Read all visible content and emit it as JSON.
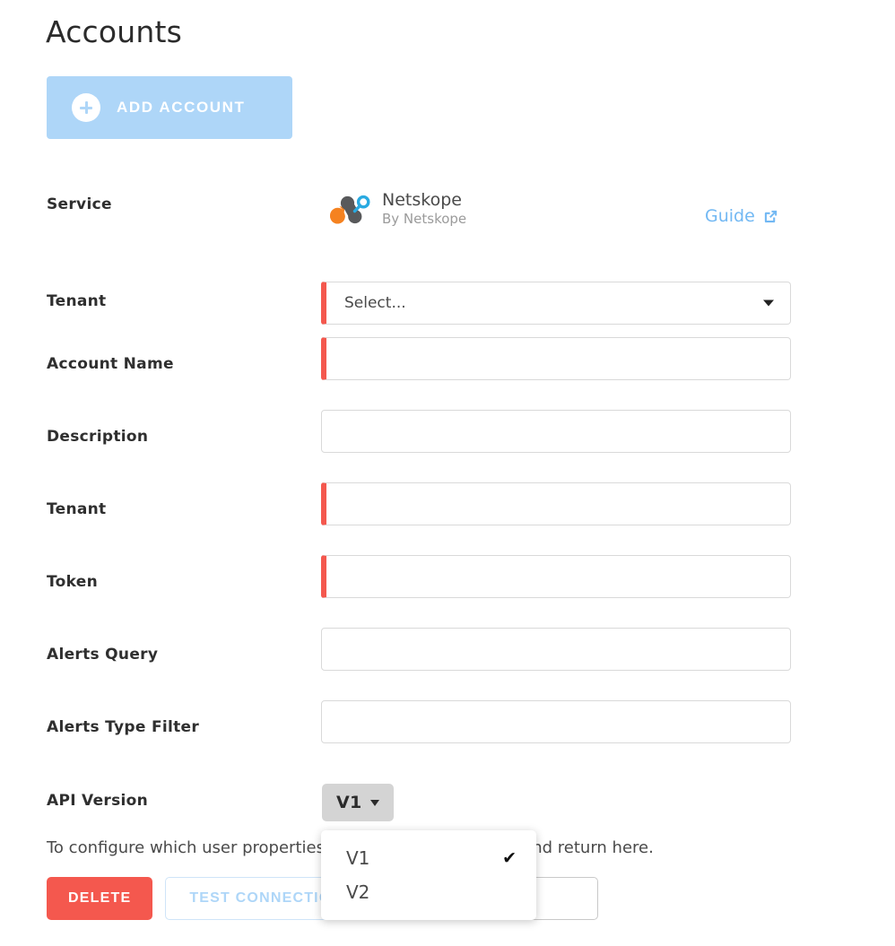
{
  "page": {
    "title": "Accounts"
  },
  "toolbar": {
    "add_account_label": "ADD ACCOUNT",
    "add_icon": "plus-circle-icon"
  },
  "service": {
    "label": "Service",
    "name": "Netskope",
    "vendor": "By Netskope",
    "logo_icon": "netskope-logo-icon",
    "guide_label": "Guide",
    "guide_icon": "external-link-icon"
  },
  "form": {
    "fields": [
      {
        "label": "Tenant",
        "type": "select",
        "value": "",
        "placeholder": "Select...",
        "required": true,
        "caret_icon": "chevron-down-icon"
      },
      {
        "label": "Account Name",
        "type": "text",
        "value": "",
        "placeholder": "",
        "required": true
      },
      {
        "label": "Description",
        "type": "text",
        "value": "",
        "placeholder": "",
        "required": false
      },
      {
        "label": "Tenant",
        "type": "text",
        "value": "",
        "placeholder": "",
        "required": true
      },
      {
        "label": "Token",
        "type": "text",
        "value": "",
        "placeholder": "",
        "required": true
      },
      {
        "label": "Alerts Query",
        "type": "text",
        "value": "",
        "placeholder": "",
        "required": false
      },
      {
        "label": "Alerts Type Filter",
        "type": "text",
        "value": "",
        "placeholder": "",
        "required": false
      }
    ]
  },
  "api_version": {
    "label": "API Version",
    "selected": "V1",
    "caret_icon": "caret-down-icon",
    "menu_open": true,
    "options": [
      {
        "label": "V1",
        "selected": true,
        "check_icon": "check-icon"
      },
      {
        "label": "V2",
        "selected": false,
        "check_icon": "check-icon"
      }
    ]
  },
  "hint": {
    "text": "To configure which user properties are synced, go to LDAP and return here."
  },
  "actions": {
    "delete_label": "DELETE",
    "test_connection_label": "TEST CONNECTION",
    "secondary_label": "",
    "tertiary_label": ""
  },
  "colors": {
    "accent_blue": "#aed6f8",
    "link_blue": "#72b8f3",
    "required_red": "#f4584e",
    "delete_red": "#f4584e",
    "dropdown_grey": "#d4d4d4",
    "logo_orange": "#f58220",
    "logo_dark": "#58595b",
    "logo_cyan": "#29aae1"
  }
}
